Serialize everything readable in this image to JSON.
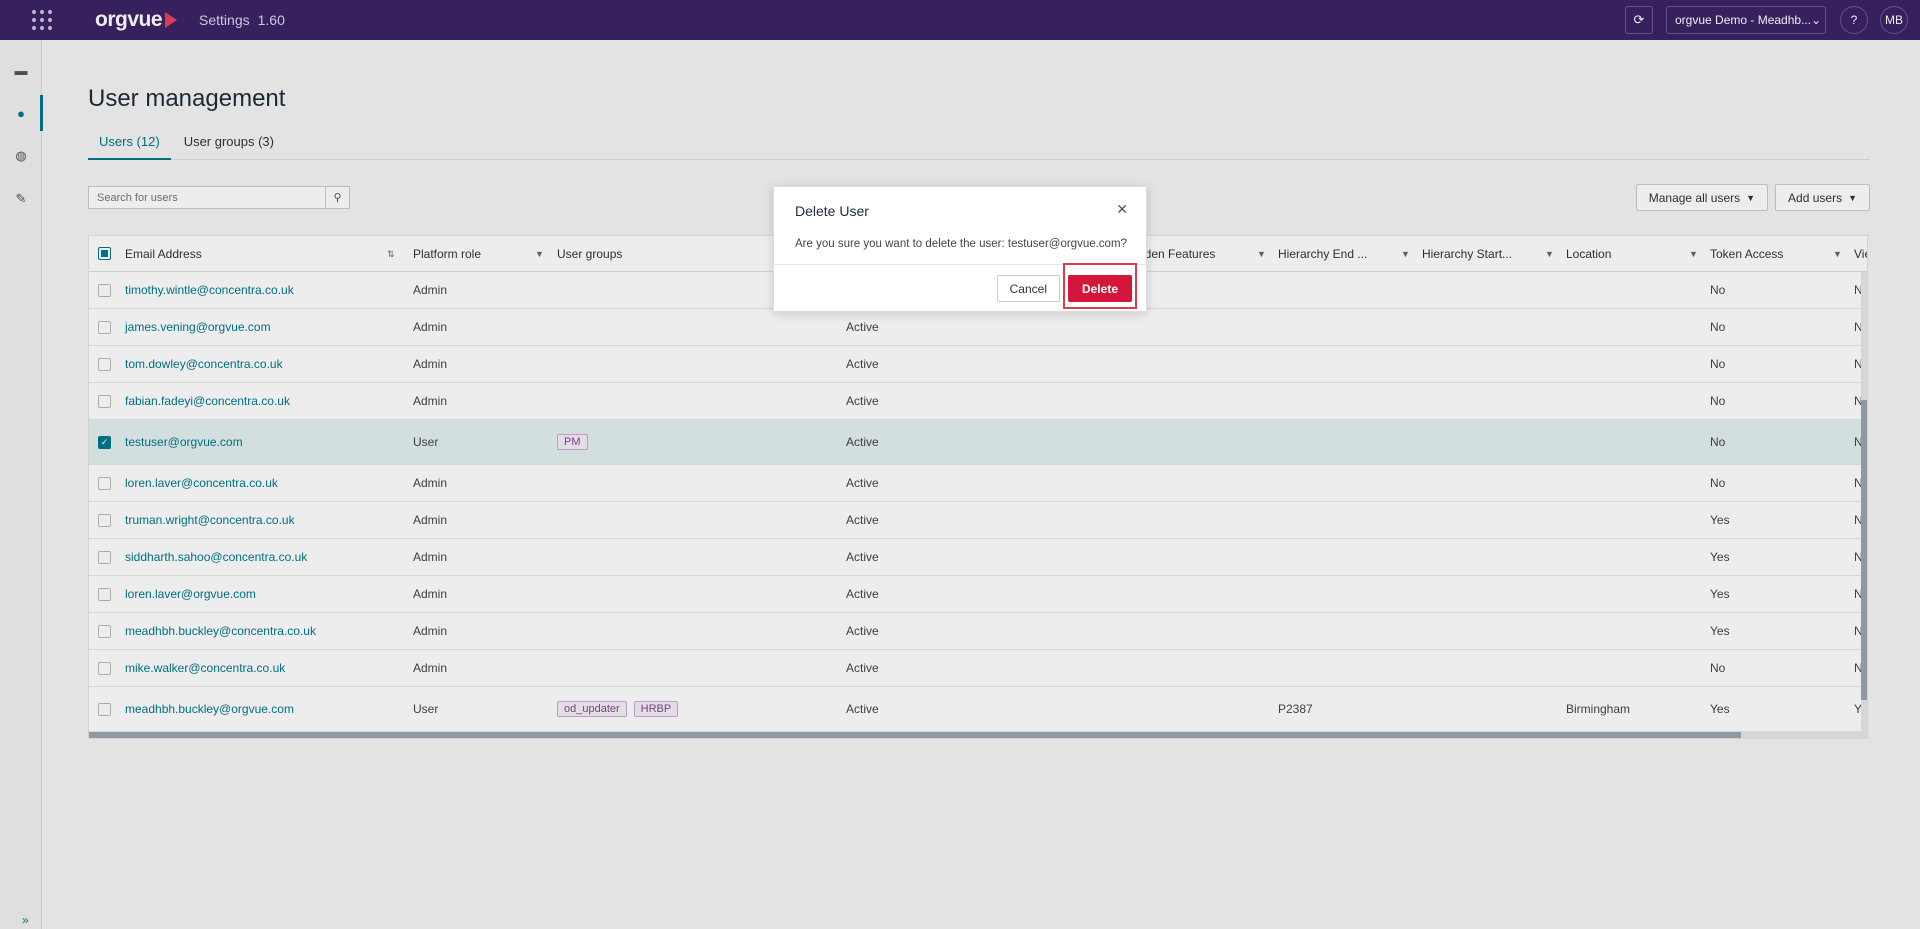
{
  "topbar": {
    "logo_text": "orgvue",
    "app_name": "Settings",
    "version": "1.60",
    "org_selector": "orgvue Demo - Meadhb...",
    "help_label": "?",
    "avatar_initials": "MB"
  },
  "sidebar": {
    "items": [
      {
        "icon": "folder-icon",
        "glyph": "▬"
      },
      {
        "icon": "user-icon",
        "glyph": "●"
      },
      {
        "icon": "palette-icon",
        "glyph": "◍"
      },
      {
        "icon": "wrench-icon",
        "glyph": "✎"
      }
    ],
    "expand_glyph": "»"
  },
  "page": {
    "title": "User management",
    "tabs": [
      {
        "label": "Users (12)",
        "active": true
      },
      {
        "label": "User groups (3)",
        "active": false
      }
    ],
    "search_placeholder": "Search for users",
    "manage_all_users": "Manage all users",
    "add_users": "Add users"
  },
  "table": {
    "columns": [
      "Email Address",
      "Platform role",
      "User groups",
      "",
      "dden Features",
      "Hierarchy End ...",
      "Hierarchy Start...",
      "Location",
      "Token Access",
      "Vie"
    ],
    "rows": [
      {
        "email": "timothy.wintle@concentra.co.uk",
        "role": "Admin",
        "groups": [],
        "status": "",
        "hier_end": "",
        "location": "",
        "token": "No",
        "view": "N",
        "selected": false
      },
      {
        "email": "james.vening@orgvue.com",
        "role": "Admin",
        "groups": [],
        "status": "Active",
        "hier_end": "",
        "location": "",
        "token": "No",
        "view": "N",
        "selected": false
      },
      {
        "email": "tom.dowley@concentra.co.uk",
        "role": "Admin",
        "groups": [],
        "status": "Active",
        "hier_end": "",
        "location": "",
        "token": "No",
        "view": "N",
        "selected": false
      },
      {
        "email": "fabian.fadeyi@concentra.co.uk",
        "role": "Admin",
        "groups": [],
        "status": "Active",
        "hier_end": "",
        "location": "",
        "token": "No",
        "view": "N",
        "selected": false
      },
      {
        "email": "testuser@orgvue.com",
        "role": "User",
        "groups": [
          "PM"
        ],
        "status": "Active",
        "hier_end": "",
        "location": "",
        "token": "No",
        "view": "N",
        "selected": true
      },
      {
        "email": "loren.laver@concentra.co.uk",
        "role": "Admin",
        "groups": [],
        "status": "Active",
        "hier_end": "",
        "location": "",
        "token": "No",
        "view": "N",
        "selected": false
      },
      {
        "email": "truman.wright@concentra.co.uk",
        "role": "Admin",
        "groups": [],
        "status": "Active",
        "hier_end": "",
        "location": "",
        "token": "Yes",
        "view": "N",
        "selected": false
      },
      {
        "email": "siddharth.sahoo@concentra.co.uk",
        "role": "Admin",
        "groups": [],
        "status": "Active",
        "hier_end": "",
        "location": "",
        "token": "Yes",
        "view": "N",
        "selected": false
      },
      {
        "email": "loren.laver@orgvue.com",
        "role": "Admin",
        "groups": [],
        "status": "Active",
        "hier_end": "",
        "location": "",
        "token": "Yes",
        "view": "N",
        "selected": false
      },
      {
        "email": "meadhbh.buckley@concentra.co.uk",
        "role": "Admin",
        "groups": [],
        "status": "Active",
        "hier_end": "",
        "location": "",
        "token": "Yes",
        "view": "N",
        "selected": false
      },
      {
        "email": "mike.walker@concentra.co.uk",
        "role": "Admin",
        "groups": [],
        "status": "Active",
        "hier_end": "",
        "location": "",
        "token": "No",
        "view": "N",
        "selected": false
      },
      {
        "email": "meadhbh.buckley@orgvue.com",
        "role": "User",
        "groups": [
          "od_updater",
          "HRBP"
        ],
        "status": "Active",
        "hier_end": "P2387",
        "location": "Birmingham",
        "token": "Yes",
        "view": "Y",
        "selected": false
      }
    ]
  },
  "modal": {
    "title": "Delete User",
    "message": "Are you sure you want to delete the user: testuser@orgvue.com?",
    "cancel": "Cancel",
    "delete": "Delete"
  },
  "colors": {
    "topbar": "#3b2466",
    "accent": "#00788a",
    "danger": "#d4163b",
    "highlight": "#e03a4a"
  }
}
